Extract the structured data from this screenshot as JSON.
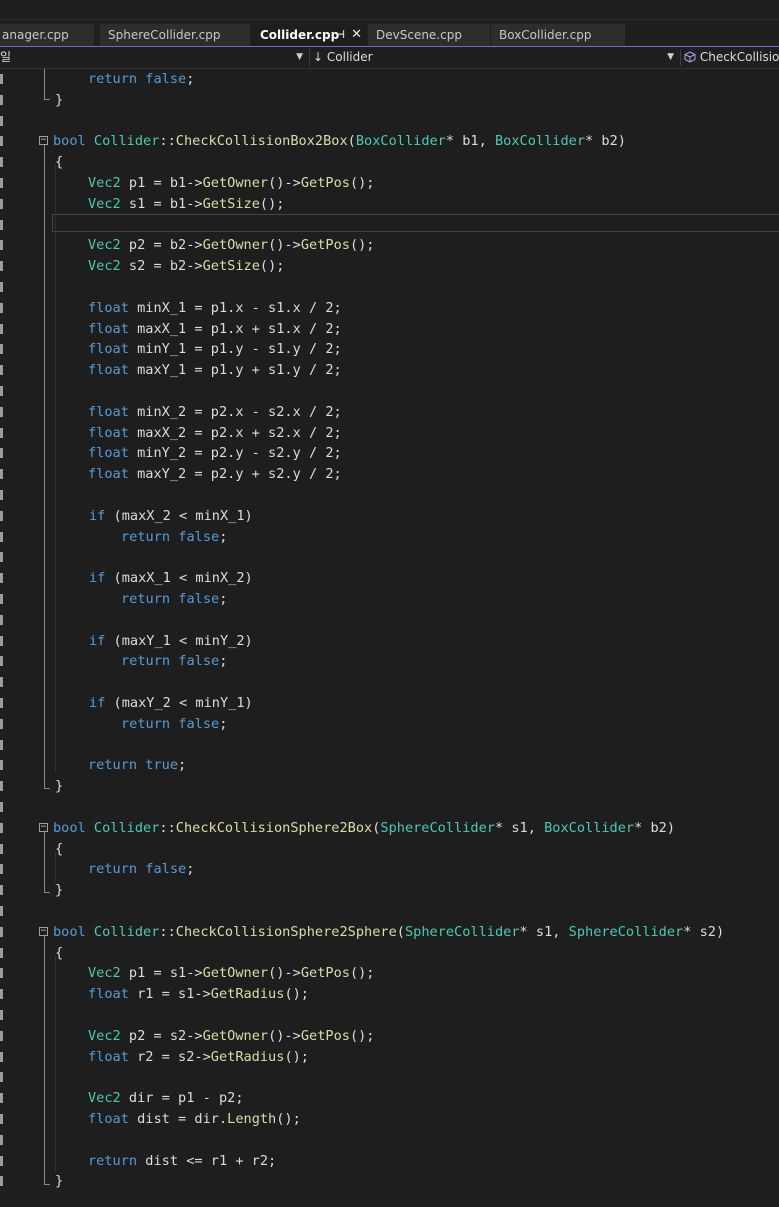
{
  "tabs": [
    {
      "label": "anager.cpp",
      "active": false
    },
    {
      "label": "SphereCollider.cpp",
      "active": false
    },
    {
      "label": "Collider.cpp",
      "active": true,
      "pin": "⊣",
      "close": "✕"
    },
    {
      "label": "DevScene.cpp",
      "active": false
    },
    {
      "label": "BoxCollider.cpp",
      "active": false
    }
  ],
  "navbar": {
    "left_label": "일",
    "middle_label": "Collider",
    "middle_icon": "↓",
    "right_label": "CheckCollision",
    "right_icon": "cube-icon"
  },
  "editor": {
    "colors": {
      "keyword": "#569cd6",
      "type": "#4ec9b0",
      "function": "#dcdcaa",
      "plain": "#dcdcdc",
      "background": "#1e1e1e",
      "accent": "#7b63c9"
    },
    "lines": [
      [
        [
          "kw",
          "return false"
        ],
        [
          "pl",
          ";"
        ]
      ],
      [
        [
          "pl",
          "}"
        ]
      ],
      [],
      [
        [
          "kw",
          "bool "
        ],
        [
          "ty",
          "Collider"
        ],
        [
          "pl",
          "::"
        ],
        [
          "fn",
          "CheckCollisionBox2Box"
        ],
        [
          "pl",
          "("
        ],
        [
          "ty",
          "BoxCollider"
        ],
        [
          "pl",
          "* b1, "
        ],
        [
          "ty",
          "BoxCollider"
        ],
        [
          "pl",
          "* b2)"
        ]
      ],
      [
        [
          "pl",
          "{"
        ]
      ],
      [
        [
          "ty",
          "Vec2"
        ],
        [
          "pl",
          " p1 = b1->"
        ],
        [
          "fn",
          "GetOwner"
        ],
        [
          "pl",
          "()->"
        ],
        [
          "fn",
          "GetPos"
        ],
        [
          "pl",
          "();"
        ]
      ],
      [
        [
          "ty",
          "Vec2"
        ],
        [
          "pl",
          " s1 = b1->"
        ],
        [
          "fn",
          "GetSize"
        ],
        [
          "pl",
          "();"
        ]
      ],
      [],
      [
        [
          "ty",
          "Vec2"
        ],
        [
          "pl",
          " p2 = b2->"
        ],
        [
          "fn",
          "GetOwner"
        ],
        [
          "pl",
          "()->"
        ],
        [
          "fn",
          "GetPos"
        ],
        [
          "pl",
          "();"
        ]
      ],
      [
        [
          "ty",
          "Vec2"
        ],
        [
          "pl",
          " s2 = b2->"
        ],
        [
          "fn",
          "GetSize"
        ],
        [
          "pl",
          "();"
        ]
      ],
      [],
      [
        [
          "kw",
          "float"
        ],
        [
          "pl",
          " minX_1 = p1.x - s1.x / 2;"
        ]
      ],
      [
        [
          "kw",
          "float"
        ],
        [
          "pl",
          " maxX_1 = p1.x + s1.x / 2;"
        ]
      ],
      [
        [
          "kw",
          "float"
        ],
        [
          "pl",
          " minY_1 = p1.y - s1.y / 2;"
        ]
      ],
      [
        [
          "kw",
          "float"
        ],
        [
          "pl",
          " maxY_1 = p1.y + s1.y / 2;"
        ]
      ],
      [],
      [
        [
          "kw",
          "float"
        ],
        [
          "pl",
          " minX_2 = p2.x - s2.x / 2;"
        ]
      ],
      [
        [
          "kw",
          "float"
        ],
        [
          "pl",
          " maxX_2 = p2.x + s2.x / 2;"
        ]
      ],
      [
        [
          "kw",
          "float"
        ],
        [
          "pl",
          " minY_2 = p2.y - s2.y / 2;"
        ]
      ],
      [
        [
          "kw",
          "float"
        ],
        [
          "pl",
          " maxY_2 = p2.y + s2.y / 2;"
        ]
      ],
      [],
      [
        [
          "kw",
          "if"
        ],
        [
          "pl",
          " (maxX_2 < minX_1)"
        ]
      ],
      [
        [
          "kw",
          "return false"
        ],
        [
          "pl",
          ";"
        ]
      ],
      [],
      [
        [
          "kw",
          "if"
        ],
        [
          "pl",
          " (maxX_1 < minX_2)"
        ]
      ],
      [
        [
          "kw",
          "return false"
        ],
        [
          "pl",
          ";"
        ]
      ],
      [],
      [
        [
          "kw",
          "if"
        ],
        [
          "pl",
          " (maxY_1 < minY_2)"
        ]
      ],
      [
        [
          "kw",
          "return false"
        ],
        [
          "pl",
          ";"
        ]
      ],
      [],
      [
        [
          "kw",
          "if"
        ],
        [
          "pl",
          " (maxY_2 < minY_1)"
        ]
      ],
      [
        [
          "kw",
          "return false"
        ],
        [
          "pl",
          ";"
        ]
      ],
      [],
      [
        [
          "kw",
          "return true"
        ],
        [
          "pl",
          ";"
        ]
      ],
      [
        [
          "pl",
          "}"
        ]
      ],
      [],
      [
        [
          "kw",
          "bool "
        ],
        [
          "ty",
          "Collider"
        ],
        [
          "pl",
          "::"
        ],
        [
          "fn",
          "CheckCollisionSphere2Box"
        ],
        [
          "pl",
          "("
        ],
        [
          "ty",
          "SphereCollider"
        ],
        [
          "pl",
          "* s1, "
        ],
        [
          "ty",
          "BoxCollider"
        ],
        [
          "pl",
          "* b2)"
        ]
      ],
      [
        [
          "pl",
          "{"
        ]
      ],
      [
        [
          "kw",
          "return false"
        ],
        [
          "pl",
          ";"
        ]
      ],
      [
        [
          "pl",
          "}"
        ]
      ],
      [],
      [
        [
          "kw",
          "bool "
        ],
        [
          "ty",
          "Collider"
        ],
        [
          "pl",
          "::"
        ],
        [
          "fn",
          "CheckCollisionSphere2Sphere"
        ],
        [
          "pl",
          "("
        ],
        [
          "ty",
          "SphereCollider"
        ],
        [
          "pl",
          "* s1, "
        ],
        [
          "ty",
          "SphereCollider"
        ],
        [
          "pl",
          "* s2)"
        ]
      ],
      [
        [
          "pl",
          "{"
        ]
      ],
      [
        [
          "ty",
          "Vec2"
        ],
        [
          "pl",
          " p1 = s1->"
        ],
        [
          "fn",
          "GetOwner"
        ],
        [
          "pl",
          "()->"
        ],
        [
          "fn",
          "GetPos"
        ],
        [
          "pl",
          "();"
        ]
      ],
      [
        [
          "kw",
          "float"
        ],
        [
          "pl",
          " r1 = s1->"
        ],
        [
          "fn",
          "GetRadius"
        ],
        [
          "pl",
          "();"
        ]
      ],
      [],
      [
        [
          "ty",
          "Vec2"
        ],
        [
          "pl",
          " p2 = s2->"
        ],
        [
          "fn",
          "GetOwner"
        ],
        [
          "pl",
          "()->"
        ],
        [
          "fn",
          "GetPos"
        ],
        [
          "pl",
          "();"
        ]
      ],
      [
        [
          "kw",
          "float"
        ],
        [
          "pl",
          " r2 = s2->"
        ],
        [
          "fn",
          "GetRadius"
        ],
        [
          "pl",
          "();"
        ]
      ],
      [],
      [
        [
          "ty",
          "Vec2"
        ],
        [
          "pl",
          " dir = p1 - p2;"
        ]
      ],
      [
        [
          "kw",
          "float"
        ],
        [
          "pl",
          " dist = dir."
        ],
        [
          "fn",
          "Length"
        ],
        [
          "pl",
          "();"
        ]
      ],
      [],
      [
        [
          "kw",
          "return"
        ],
        [
          "pl",
          " dist <= r1 + r2;"
        ]
      ],
      [
        [
          "pl",
          "}"
        ]
      ]
    ]
  }
}
